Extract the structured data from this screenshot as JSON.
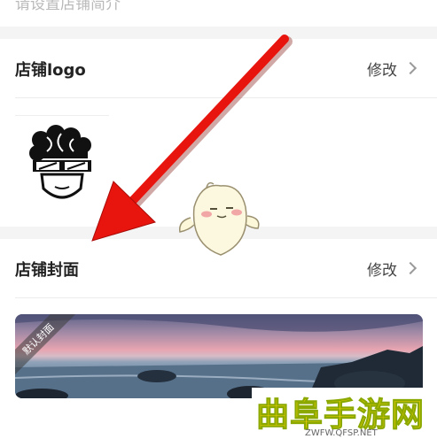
{
  "store_intro": {
    "placeholder": "请设置店铺简介"
  },
  "logo_section": {
    "title": "店铺logo",
    "action_label": "修改"
  },
  "cover_section": {
    "title": "店铺封面",
    "action_label": "修改",
    "badge": "默认封面"
  },
  "watermark": {
    "title": "曲阜手游网",
    "url": "ZWFW.QFSP.NET"
  },
  "icons": {
    "chevron": "chevron-right-icon",
    "arrow": "red-arrow",
    "mascot": "mascot-sticker"
  },
  "colors": {
    "arrow": "#e8140e",
    "watermark": "#f5d400"
  }
}
